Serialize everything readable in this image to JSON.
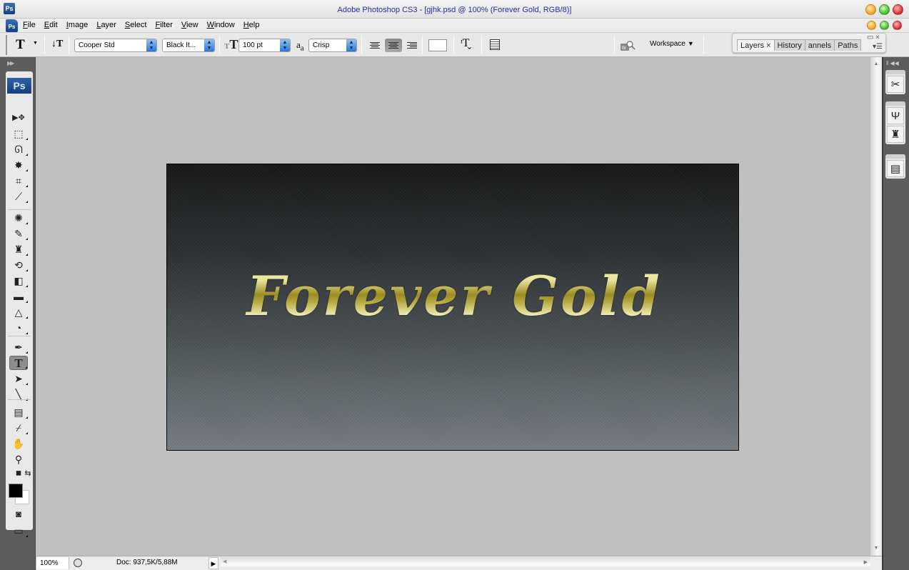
{
  "window": {
    "title": "Adobe Photoshop CS3 - [gjhk.psd @ 100% (Forever Gold, RGB/8)]",
    "app_icon": "Ps"
  },
  "menubar": {
    "items": [
      "File",
      "Edit",
      "Image",
      "Layer",
      "Select",
      "Filter",
      "View",
      "Window",
      "Help"
    ]
  },
  "options": {
    "tool_icon": "T",
    "orientation_icon": "T-vertical",
    "font_family": "Cooper Std",
    "font_style": "Black It...",
    "font_size": "100 pt",
    "antialias": "Crisp",
    "alignment_active": "center",
    "text_color": "#ffffff",
    "workspace_label": "Workspace"
  },
  "panels": {
    "tabs": [
      "Layers",
      "History",
      "annels",
      "Paths"
    ],
    "active_tab": "Layers"
  },
  "toolbox": {
    "badge": "Ps",
    "tools": [
      {
        "name": "move-tool",
        "glyph": "▶✥"
      },
      {
        "name": "marquee-tool",
        "glyph": "⬚"
      },
      {
        "name": "lasso-tool",
        "glyph": "ᘏ"
      },
      {
        "name": "magic-wand-tool",
        "glyph": "✸"
      },
      {
        "name": "crop-tool",
        "glyph": "⌗"
      },
      {
        "name": "slice-tool",
        "glyph": "⟋"
      },
      {
        "name": "healing-brush-tool",
        "glyph": "✺"
      },
      {
        "name": "brush-tool",
        "glyph": "✎"
      },
      {
        "name": "clone-stamp-tool",
        "glyph": "♜"
      },
      {
        "name": "history-brush-tool",
        "glyph": "⟲"
      },
      {
        "name": "eraser-tool",
        "glyph": "◧"
      },
      {
        "name": "gradient-tool",
        "glyph": "▬"
      },
      {
        "name": "blur-tool",
        "glyph": "△"
      },
      {
        "name": "dodge-tool",
        "glyph": "◔"
      },
      {
        "name": "pen-tool",
        "glyph": "✒"
      },
      {
        "name": "type-tool",
        "glyph": "T"
      },
      {
        "name": "path-selection-tool",
        "glyph": "➤"
      },
      {
        "name": "line-tool",
        "glyph": "╲"
      },
      {
        "name": "notes-tool",
        "glyph": "▤"
      },
      {
        "name": "eyedropper-tool",
        "glyph": "⌿"
      },
      {
        "name": "hand-tool",
        "glyph": "✋"
      },
      {
        "name": "zoom-tool",
        "glyph": "⚲"
      }
    ],
    "foreground_color": "#000000",
    "background_color": "#ffffff"
  },
  "right_dock": {
    "buttons": [
      "tool-presets-icon",
      "brushes-icon",
      "clone-source-icon",
      "paragraph-icon"
    ]
  },
  "canvas": {
    "text": "Forever Gold",
    "layer_name": "Forever Gold"
  },
  "status": {
    "zoom": "100%",
    "doc_info": "Doc: 937,5K/5,88M"
  }
}
